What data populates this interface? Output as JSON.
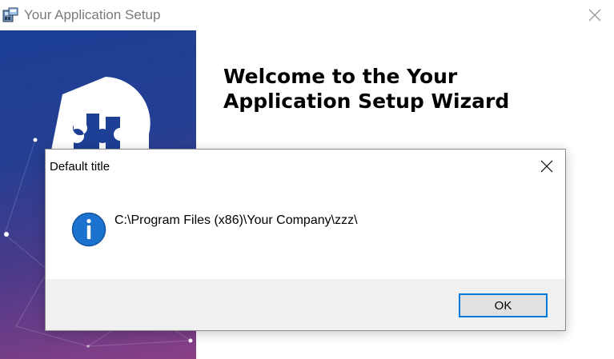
{
  "installer": {
    "title": "Your Application Setup",
    "heading_line1": "Welcome to the Your",
    "heading_line2": "Application Setup Wizard"
  },
  "dialog": {
    "title": "Default title",
    "message": "C:\\Program Files (x86)\\Your Company\\zzz\\",
    "ok_label": "OK",
    "icon": "info-icon"
  },
  "colors": {
    "banner_top": "#1d3f96",
    "banner_bottom": "#8a3f86",
    "info_blue": "#1c72cf",
    "button_focus": "#0078d7"
  },
  "icons": {
    "installer_app": "setup-app-icon",
    "installer_close": "close-icon",
    "dialog_close": "close-icon",
    "banner_logo": "puzzle-logo"
  }
}
